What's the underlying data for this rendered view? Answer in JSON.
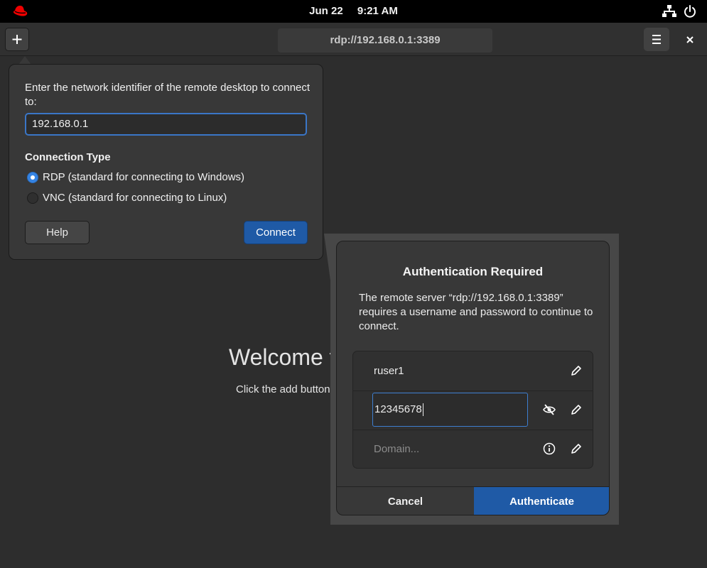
{
  "topbar": {
    "date": "Jun 22",
    "time": "9:21 AM",
    "logo_icon": "redhat-logo",
    "tray_icons": [
      "network-icon",
      "power-icon"
    ]
  },
  "header": {
    "url": "rdp://192.168.0.1:3389",
    "add_icon": "plus-icon",
    "menu_icon": "hamburger-icon",
    "close_icon": "close-icon"
  },
  "welcome": {
    "title": "Welcome t",
    "subtitle": "Click the add button"
  },
  "popover": {
    "prompt": "Enter the network identifier of the remote desktop to connect to:",
    "address_value": "192.168.0.1",
    "connection_type_label": "Connection Type",
    "options": [
      {
        "label": "RDP (standard for connecting to Windows)",
        "selected": true
      },
      {
        "label": "VNC (standard for connecting to Linux)",
        "selected": false
      }
    ],
    "help_label": "Help",
    "connect_label": "Connect"
  },
  "auth_dialog": {
    "title": "Authentication Required",
    "message": "The remote server “rdp://192.168.0.1:3389” requires a username and password to continue to connect.",
    "username": "ruser1",
    "password": "12345678",
    "domain_placeholder": "Domain...",
    "cancel_label": "Cancel",
    "authenticate_label": "Authenticate"
  },
  "colors": {
    "accent": "#1f5aa6",
    "focus": "#3584e4",
    "logo_red": "#ee0000"
  }
}
